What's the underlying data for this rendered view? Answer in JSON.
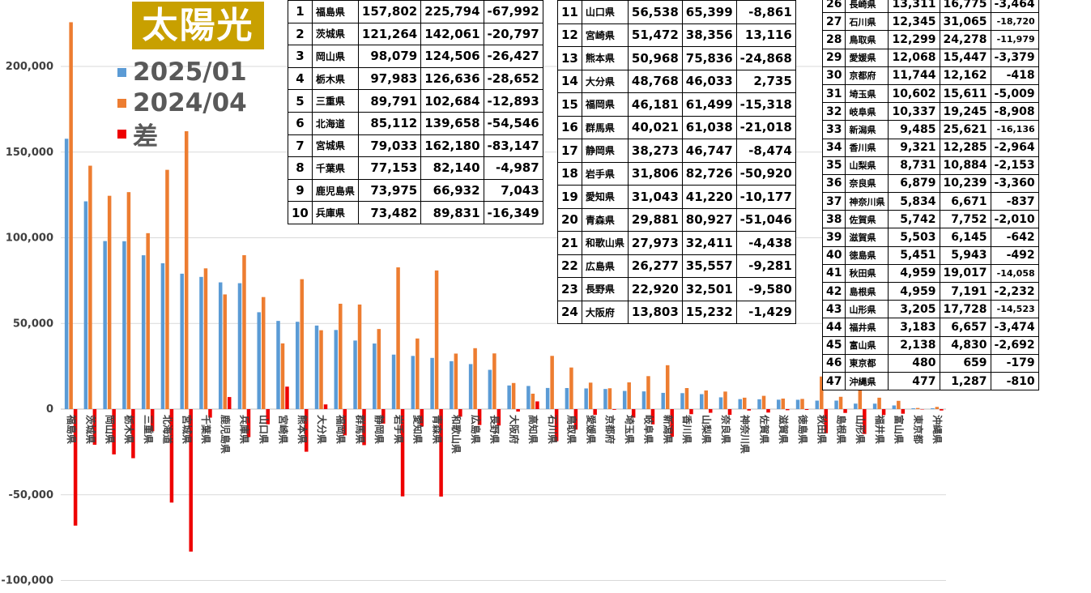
{
  "title": "太陽光",
  "colors": {
    "s2025": "#5b9bd5",
    "s2024": "#ed7d31",
    "diff": "#ee0000",
    "title_bg": "#c8a000"
  },
  "legend": [
    {
      "label": "2025/01",
      "color": "#5b9bd5"
    },
    {
      "label": "2024/04",
      "color": "#ed7d31"
    },
    {
      "label": "差",
      "color": "#ee0000"
    }
  ],
  "chart_data": {
    "type": "bar",
    "title": "太陽光",
    "ylim": [
      -100000,
      225000
    ],
    "yticks": [
      -100000,
      -50000,
      0,
      50000,
      100000,
      150000,
      200000
    ],
    "ytick_labels": [
      "-100,000",
      "-50,000",
      "0",
      "50,000",
      "100,000",
      "150,000",
      "200,000"
    ],
    "legend_position": "top-left",
    "categories": [
      "福島県",
      "茨城県",
      "岡山県",
      "栃木県",
      "三重県",
      "北海道",
      "宮城県",
      "千葉県",
      "鹿児島県",
      "兵庫県",
      "山口県",
      "宮崎県",
      "熊本県",
      "大分県",
      "福岡県",
      "群馬県",
      "静岡県",
      "岩手県",
      "愛知県",
      "青森県",
      "和歌山県",
      "広島県",
      "長野県",
      "大阪府",
      "高知県",
      "石川県",
      "鳥取県",
      "愛媛県",
      "京都府",
      "埼玉県",
      "岐阜県",
      "新潟県",
      "香川県",
      "山梨県",
      "奈良県",
      "神奈川県",
      "佐賀県",
      "滋賀県",
      "徳島県",
      "秋田県",
      "島根県",
      "山形県",
      "福井県",
      "富山県",
      "東京都",
      "沖縄県"
    ],
    "series": [
      {
        "name": "2025/01",
        "values": [
          157802,
          121264,
          98079,
          97983,
          89791,
          85112,
          79033,
          77153,
          73975,
          73482,
          56538,
          51472,
          50968,
          48768,
          46181,
          40021,
          38273,
          31806,
          31043,
          29881,
          27973,
          26277,
          22920,
          13803,
          13500,
          12345,
          12299,
          12068,
          11744,
          10602,
          10337,
          9485,
          9321,
          8731,
          6879,
          5834,
          5742,
          5503,
          5451,
          4959,
          4959,
          3205,
          3183,
          2138,
          480,
          477
        ]
      },
      {
        "name": "2024/04",
        "values": [
          225794,
          142061,
          124506,
          126636,
          102684,
          139658,
          162180,
          82140,
          66932,
          89831,
          65399,
          38356,
          75836,
          46033,
          61499,
          61038,
          46747,
          82726,
          41220,
          80927,
          32411,
          35557,
          32501,
          15232,
          9000,
          31065,
          24278,
          15447,
          12162,
          15611,
          19245,
          25621,
          12285,
          10884,
          10239,
          6671,
          7752,
          6145,
          5943,
          19017,
          7191,
          17728,
          6657,
          4830,
          659,
          1287
        ]
      },
      {
        "name": "差",
        "values": [
          -67992,
          -20797,
          -26427,
          -28652,
          -12893,
          -54546,
          -83147,
          -4987,
          7043,
          -16349,
          -8861,
          13116,
          -24868,
          2735,
          -15318,
          -21018,
          -8474,
          -50920,
          -10177,
          -51046,
          -4438,
          -9281,
          -9580,
          -1429,
          4500,
          -18720,
          -11979,
          -3379,
          -418,
          -5009,
          -8908,
          -16136,
          -2964,
          -2153,
          -3360,
          -837,
          -2010,
          -642,
          -492,
          -14058,
          -2232,
          -14523,
          -3474,
          -2692,
          -179,
          -810
        ]
      }
    ]
  },
  "table1": [
    [
      "1",
      "福島県",
      "157,802",
      "225,794",
      "-67,992"
    ],
    [
      "2",
      "茨城県",
      "121,264",
      "142,061",
      "-20,797"
    ],
    [
      "3",
      "岡山県",
      "98,079",
      "124,506",
      "-26,427"
    ],
    [
      "4",
      "栃木県",
      "97,983",
      "126,636",
      "-28,652"
    ],
    [
      "5",
      "三重県",
      "89,791",
      "102,684",
      "-12,893"
    ],
    [
      "6",
      "北海道",
      "85,112",
      "139,658",
      "-54,546"
    ],
    [
      "7",
      "宮城県",
      "79,033",
      "162,180",
      "-83,147"
    ],
    [
      "8",
      "千葉県",
      "77,153",
      "82,140",
      "-4,987"
    ],
    [
      "9",
      "鹿児島県",
      "73,975",
      "66,932",
      "7,043"
    ],
    [
      "10",
      "兵庫県",
      "73,482",
      "89,831",
      "-16,349"
    ]
  ],
  "table2": [
    [
      "11",
      "山口県",
      "56,538",
      "65,399",
      "-8,861"
    ],
    [
      "12",
      "宮崎県",
      "51,472",
      "38,356",
      "13,116"
    ],
    [
      "13",
      "熊本県",
      "50,968",
      "75,836",
      "-24,868"
    ],
    [
      "14",
      "大分県",
      "48,768",
      "46,033",
      "2,735"
    ],
    [
      "15",
      "福岡県",
      "46,181",
      "61,499",
      "-15,318"
    ],
    [
      "16",
      "群馬県",
      "40,021",
      "61,038",
      "-21,018"
    ],
    [
      "17",
      "静岡県",
      "38,273",
      "46,747",
      "-8,474"
    ],
    [
      "18",
      "岩手県",
      "31,806",
      "82,726",
      "-50,920"
    ],
    [
      "19",
      "愛知県",
      "31,043",
      "41,220",
      "-10,177"
    ],
    [
      "20",
      "青森県",
      "29,881",
      "80,927",
      "-51,046"
    ],
    [
      "21",
      "和歌山県",
      "27,973",
      "32,411",
      "-4,438"
    ],
    [
      "22",
      "広島県",
      "26,277",
      "35,557",
      "-9,281"
    ],
    [
      "23",
      "長野県",
      "22,920",
      "32,501",
      "-9,580"
    ],
    [
      "24",
      "大阪府",
      "13,803",
      "15,232",
      "-1,429"
    ]
  ],
  "table3": [
    [
      "26",
      "長崎県",
      "13,311",
      "16,775",
      "-3,464"
    ],
    [
      "27",
      "石川県",
      "12,345",
      "31,065",
      "-18,720"
    ],
    [
      "28",
      "鳥取県",
      "12,299",
      "24,278",
      "-11,979"
    ],
    [
      "29",
      "愛媛県",
      "12,068",
      "15,447",
      "-3,379"
    ],
    [
      "30",
      "京都府",
      "11,744",
      "12,162",
      "-418"
    ],
    [
      "31",
      "埼玉県",
      "10,602",
      "15,611",
      "-5,009"
    ],
    [
      "32",
      "岐阜県",
      "10,337",
      "19,245",
      "-8,908"
    ],
    [
      "33",
      "新潟県",
      "9,485",
      "25,621",
      "-16,136"
    ],
    [
      "34",
      "香川県",
      "9,321",
      "12,285",
      "-2,964"
    ],
    [
      "35",
      "山梨県",
      "8,731",
      "10,884",
      "-2,153"
    ],
    [
      "36",
      "奈良県",
      "6,879",
      "10,239",
      "-3,360"
    ],
    [
      "37",
      "神奈川県",
      "5,834",
      "6,671",
      "-837"
    ],
    [
      "38",
      "佐賀県",
      "5,742",
      "7,752",
      "-2,010"
    ],
    [
      "39",
      "滋賀県",
      "5,503",
      "6,145",
      "-642"
    ],
    [
      "40",
      "徳島県",
      "5,451",
      "5,943",
      "-492"
    ],
    [
      "41",
      "秋田県",
      "4,959",
      "19,017",
      "-14,058"
    ],
    [
      "42",
      "島根県",
      "4,959",
      "7,191",
      "-2,232"
    ],
    [
      "43",
      "山形県",
      "3,205",
      "17,728",
      "-14,523"
    ],
    [
      "44",
      "福井県",
      "3,183",
      "6,657",
      "-3,474"
    ],
    [
      "45",
      "富山県",
      "2,138",
      "4,830",
      "-2,692"
    ],
    [
      "46",
      "東京都",
      "480",
      "659",
      "-179"
    ],
    [
      "47",
      "沖縄県",
      "477",
      "1,287",
      "-810"
    ]
  ]
}
